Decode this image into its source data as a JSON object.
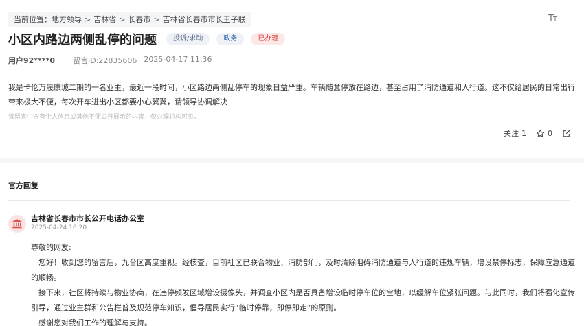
{
  "breadcrumb": {
    "items": [
      "当前位置：地方领导",
      "吉林省",
      "长春市",
      "吉林省长春市市长王子联"
    ],
    "separator": ">"
  },
  "font_button": {
    "icon": "font-size-icon",
    "label_big": "T",
    "label_small": "T"
  },
  "message": {
    "title": "小区内路边两侧乱停的问题",
    "tags": {
      "type": "投诉/求助",
      "dept": "政务",
      "status": "已办理"
    },
    "user": "用户92****0",
    "id": "留言ID:22835606",
    "datetime": "2025-04-17 11:36",
    "content": "我是卡伦万晟康城二期的一名业主，最近一段时间，小区路边两侧乱停车的现象日益严重。车辆随意停放在路边，甚至占用了消防通道和人行道。这不仅给居民的日常出行带来极大不便，每次开车进出小区都要小心翼翼，请领导协调解决",
    "notice": "该留言中含有个人信息或其他不便公开展示的内容，仅办理机构可见。"
  },
  "actions": {
    "follow_label": "关注",
    "follow_count": "1",
    "star_count": "0",
    "star_icon": "star-icon",
    "share_icon": "share-icon"
  },
  "reply": {
    "heading": "官方回复",
    "org_icon": "government-building-icon",
    "org_name": "吉林省长春市市长公开电话办公室",
    "date": "2025-04-24 16:20",
    "greeting": "尊敬的网友:",
    "paragraphs": [
      "您好！收到您的留言后，九台区高度重视。经核查，目前社区已联合物业、消防部门，及时清除阻碍消防通道与人行道的违规车辆，增设禁停标志，保障应急通道的顺畅。",
      "接下来，社区将持续与物业协商，在违停频发区域增设摄像头，并调查小区内是否具备增设临时停车位的空地，以缓解车位紧张问题。与此同时，我们将强化宣传引导，通过业主群和公告栏普及规范停车知识，倡导居民实行“临时停靠，即停即走”的原则。",
      "感谢您对我们工作的理解与支持。"
    ]
  },
  "colors": {
    "status_red": "#d63a3a",
    "dept_blue": "#3d6fb5",
    "band": "#f5f6f8"
  }
}
